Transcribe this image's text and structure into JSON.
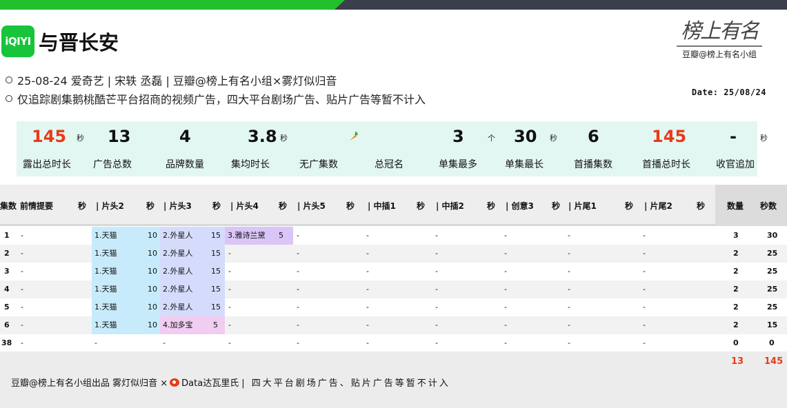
{
  "header": {
    "logo_text": "iQIYI",
    "title": "与晋长安",
    "brand_calligraphy": "榜上有名",
    "brand_sub": "豆瓣@榜上有名小组"
  },
  "info": {
    "line1": "25-08-24  爱奇艺 |  宋轶 丞磊 | 豆瓣@榜上有名小组×雾灯似归音",
    "line2": "仅追踪剧集鹅桃酷芒平台招商的视频广告，四大平台剧场广告、贴片广告等暂不计入",
    "date": "Date: 25/08/24"
  },
  "stats": [
    {
      "value": "145",
      "unit": "秒",
      "label": "露出总时长",
      "red": true
    },
    {
      "value": "13",
      "unit": "",
      "label": "广告总数",
      "red": false
    },
    {
      "value": "4",
      "unit": "",
      "label": "品牌数量",
      "red": false
    },
    {
      "value": "3.8",
      "unit": "秒",
      "label": "集均时长",
      "red": false
    },
    {
      "value": "",
      "unit": "",
      "label": "无广集数",
      "red": false,
      "icon": "carrot-icon"
    },
    {
      "value": "",
      "unit": "",
      "label": "总冠名",
      "red": false
    },
    {
      "value": "3",
      "unit": "个",
      "label": "单集最多",
      "red": false
    },
    {
      "value": "30",
      "unit": "秒",
      "label": "单集最长",
      "red": false
    },
    {
      "value": "6",
      "unit": "",
      "label": "首播集数",
      "red": false
    },
    {
      "value": "145",
      "unit": "",
      "label": "首播总时长",
      "red": true
    },
    {
      "value": "-",
      "unit": "秒",
      "label": "收官追加",
      "red": false
    }
  ],
  "table": {
    "headers": [
      "集数",
      "前情提要",
      "秒",
      "| 片头2",
      "秒",
      "| 片头3",
      "秒",
      "| 片头4",
      "秒",
      "| 片头5",
      "秒",
      "| 中插1",
      "秒",
      "| 中插2",
      "秒",
      "| 创意3",
      "秒",
      "| 片尾1",
      "秒",
      "| 片尾2",
      "秒",
      "数量",
      "秒数"
    ],
    "rows": [
      {
        "ep": "1",
        "recap": "-",
        "h2": "1.天猫",
        "h2s": "10",
        "h3": "2.外星人",
        "h3s": "15",
        "h4": "3.雅诗兰黛",
        "h4s": "5",
        "h5": "-",
        "m1": "-",
        "m2": "-",
        "c3": "-",
        "e1": "-",
        "e2": "-",
        "count": "3",
        "secs": "30"
      },
      {
        "ep": "2",
        "recap": "-",
        "h2": "1.天猫",
        "h2s": "10",
        "h3": "2.外星人",
        "h3s": "15",
        "h4": "-",
        "h4s": "",
        "h5": "-",
        "m1": "-",
        "m2": "-",
        "c3": "-",
        "e1": "-",
        "e2": "-",
        "count": "2",
        "secs": "25"
      },
      {
        "ep": "3",
        "recap": "-",
        "h2": "1.天猫",
        "h2s": "10",
        "h3": "2.外星人",
        "h3s": "15",
        "h4": "-",
        "h4s": "",
        "h5": "-",
        "m1": "-",
        "m2": "-",
        "c3": "-",
        "e1": "-",
        "e2": "-",
        "count": "2",
        "secs": "25"
      },
      {
        "ep": "4",
        "recap": "-",
        "h2": "1.天猫",
        "h2s": "10",
        "h3": "2.外星人",
        "h3s": "15",
        "h4": "-",
        "h4s": "",
        "h5": "-",
        "m1": "-",
        "m2": "-",
        "c3": "-",
        "e1": "-",
        "e2": "-",
        "count": "2",
        "secs": "25"
      },
      {
        "ep": "5",
        "recap": "-",
        "h2": "1.天猫",
        "h2s": "10",
        "h3": "2.外星人",
        "h3s": "15",
        "h4": "-",
        "h4s": "",
        "h5": "-",
        "m1": "-",
        "m2": "-",
        "c3": "-",
        "e1": "-",
        "e2": "-",
        "count": "2",
        "secs": "25"
      },
      {
        "ep": "6",
        "recap": "-",
        "h2": "1.天猫",
        "h2s": "10",
        "h3": "4.加多宝",
        "h3s": "5",
        "h4": "-",
        "h4s": "",
        "h5": "-",
        "m1": "-",
        "m2": "-",
        "c3": "-",
        "e1": "-",
        "e2": "-",
        "count": "2",
        "secs": "15"
      },
      {
        "ep": "38",
        "recap": "-",
        "h2": "-",
        "h2s": "",
        "h3": "-",
        "h3s": "",
        "h4": "-",
        "h4s": "",
        "h5": "-",
        "m1": "-",
        "m2": "-",
        "c3": "-",
        "e1": "-",
        "e2": "-",
        "count": "0",
        "secs": "0"
      }
    ],
    "totals": {
      "count": "13",
      "secs": "145"
    }
  },
  "footer": {
    "credit": "豆瓣@榜上有名小组出品  雾灯似归音 ×",
    "weibo_name": "Data达瓦里氏",
    "note": "|  四大平台剧场广告、贴片广告等暂不计入"
  },
  "colors": {
    "accent_green": "#22c02a",
    "stat_red": "#e83a1a",
    "stats_bg": "#e3f7f2",
    "cyan": "#c8ebfb",
    "lavender": "#d5dcfb",
    "purple": "#d9c5f6",
    "pink": "#f1cdf2"
  }
}
